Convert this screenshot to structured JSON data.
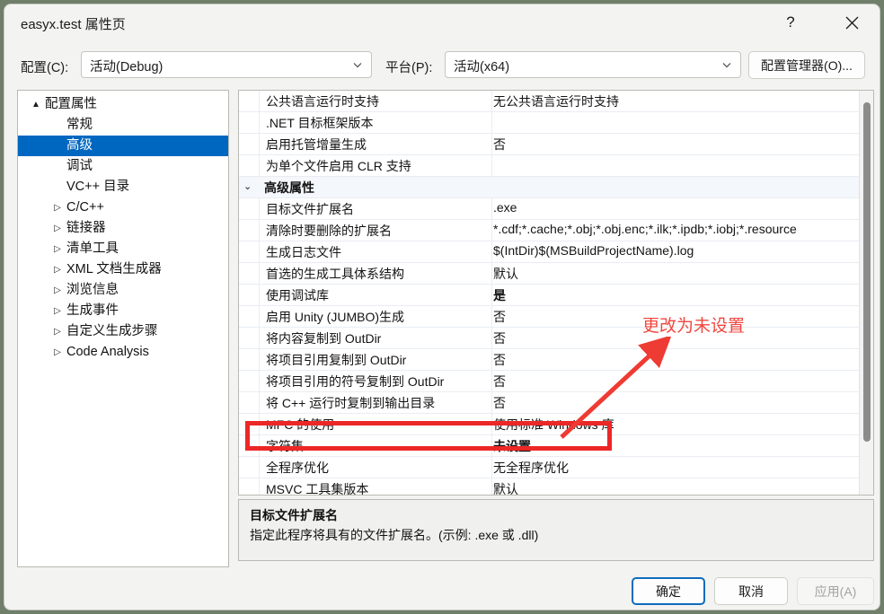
{
  "window": {
    "title": "easyx.test 属性页",
    "help_icon": "help-icon",
    "close_icon": "close-icon"
  },
  "config_row": {
    "config_label": "配置(C):",
    "config_value": "活动(Debug)",
    "platform_label": "平台(P):",
    "platform_value": "活动(x64)",
    "config_manager_button": "配置管理器(O)..."
  },
  "tree": {
    "items": [
      {
        "label": "配置属性",
        "indent": 6,
        "twisty": "▲",
        "selected": false
      },
      {
        "label": "常规",
        "indent": 30,
        "twisty": "",
        "selected": false
      },
      {
        "label": "高级",
        "indent": 30,
        "twisty": "",
        "selected": true
      },
      {
        "label": "调试",
        "indent": 30,
        "twisty": "",
        "selected": false
      },
      {
        "label": "VC++ 目录",
        "indent": 30,
        "twisty": "",
        "selected": false
      },
      {
        "label": "C/C++",
        "indent": 30,
        "twisty": "▷",
        "selected": false
      },
      {
        "label": "链接器",
        "indent": 30,
        "twisty": "▷",
        "selected": false
      },
      {
        "label": "清单工具",
        "indent": 30,
        "twisty": "▷",
        "selected": false
      },
      {
        "label": "XML 文档生成器",
        "indent": 30,
        "twisty": "▷",
        "selected": false
      },
      {
        "label": "浏览信息",
        "indent": 30,
        "twisty": "▷",
        "selected": false
      },
      {
        "label": "生成事件",
        "indent": 30,
        "twisty": "▷",
        "selected": false
      },
      {
        "label": "自定义生成步骤",
        "indent": 30,
        "twisty": "▷",
        "selected": false
      },
      {
        "label": "Code Analysis",
        "indent": 30,
        "twisty": "▷",
        "selected": false
      }
    ]
  },
  "grid": {
    "rows": [
      {
        "name": "公共语言运行时支持",
        "value": "无公共语言运行时支持",
        "group": false,
        "bold": false
      },
      {
        "name": ".NET 目标框架版本",
        "value": "",
        "group": false,
        "bold": false
      },
      {
        "name": "启用托管增量生成",
        "value": "否",
        "group": false,
        "bold": false
      },
      {
        "name": "为单个文件启用 CLR 支持",
        "value": "",
        "group": false,
        "bold": false
      },
      {
        "name": "高级属性",
        "value": "",
        "group": true,
        "bold": false
      },
      {
        "name": "目标文件扩展名",
        "value": ".exe",
        "group": false,
        "bold": false
      },
      {
        "name": "清除时要删除的扩展名",
        "value": "*.cdf;*.cache;*.obj;*.obj.enc;*.ilk;*.ipdb;*.iobj;*.resource",
        "group": false,
        "bold": false
      },
      {
        "name": "生成日志文件",
        "value": "$(IntDir)$(MSBuildProjectName).log",
        "group": false,
        "bold": false
      },
      {
        "name": "首选的生成工具体系结构",
        "value": "默认",
        "group": false,
        "bold": false
      },
      {
        "name": "使用调试库",
        "value": "是",
        "group": false,
        "bold": true
      },
      {
        "name": "启用 Unity (JUMBO)生成",
        "value": "否",
        "group": false,
        "bold": false
      },
      {
        "name": "将内容复制到 OutDir",
        "value": "否",
        "group": false,
        "bold": false
      },
      {
        "name": "将项目引用复制到 OutDir",
        "value": "否",
        "group": false,
        "bold": false
      },
      {
        "name": "将项目引用的符号复制到 OutDir",
        "value": "否",
        "group": false,
        "bold": false
      },
      {
        "name": "将 C++ 运行时复制到输出目录",
        "value": "否",
        "group": false,
        "bold": false
      },
      {
        "name": "MFC 的使用",
        "value": "使用标准 Windows 库",
        "group": false,
        "bold": false
      },
      {
        "name": "字符集",
        "value": "未设置",
        "group": false,
        "bold": true
      },
      {
        "name": "全程序优化",
        "value": "无全程序优化",
        "group": false,
        "bold": false
      },
      {
        "name": "MSVC 工具集版本",
        "value": "默认",
        "group": false,
        "bold": false
      }
    ]
  },
  "description": {
    "title": "目标文件扩展名",
    "body": "指定此程序将具有的文件扩展名。(示例: .exe 或 .dll)"
  },
  "footer": {
    "ok": "确定",
    "cancel": "取消",
    "apply": "应用(A)"
  },
  "annotation": {
    "text": "更改为未设置",
    "color": "#f0473f",
    "box_color": "#ec2727"
  }
}
